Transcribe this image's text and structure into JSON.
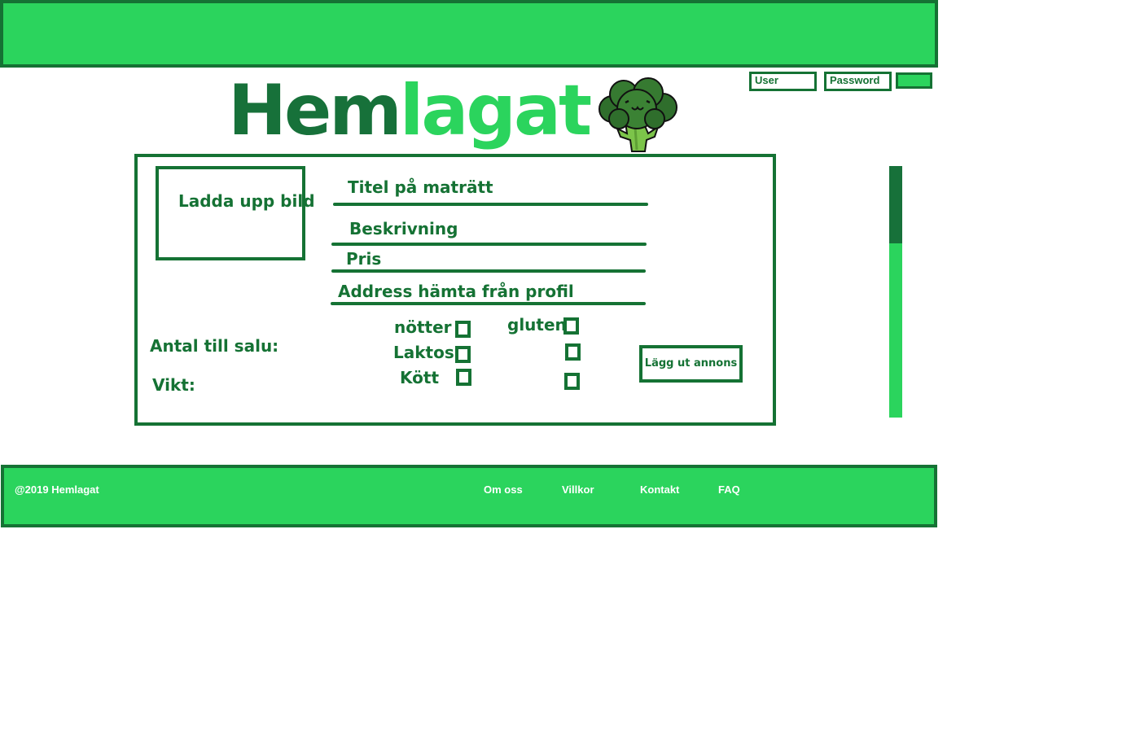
{
  "header": {
    "user_placeholder": "User",
    "password_placeholder": "Password"
  },
  "logo": {
    "part1": "Hem",
    "part2": "lagat"
  },
  "form": {
    "upload_label": "Ladda upp bild",
    "title_label": "Titel på maträtt",
    "description_label": "Beskrivning",
    "price_label": "Pris",
    "address_label": "Address hämta från profil",
    "quantity_label": "Antal till salu:",
    "weight_label": "Vikt:",
    "allergens": {
      "nuts": "nötter",
      "gluten": "gluten",
      "lactose": "Laktos",
      "meat": "Kött"
    },
    "publish_button": "Lägg ut annons"
  },
  "footer": {
    "copyright": "@2019 Hemlagat",
    "links": [
      "Om oss",
      "Villkor",
      "Kontakt",
      "FAQ"
    ]
  },
  "colors": {
    "brand_light": "#2bd45d",
    "brand_dark": "#157234"
  }
}
